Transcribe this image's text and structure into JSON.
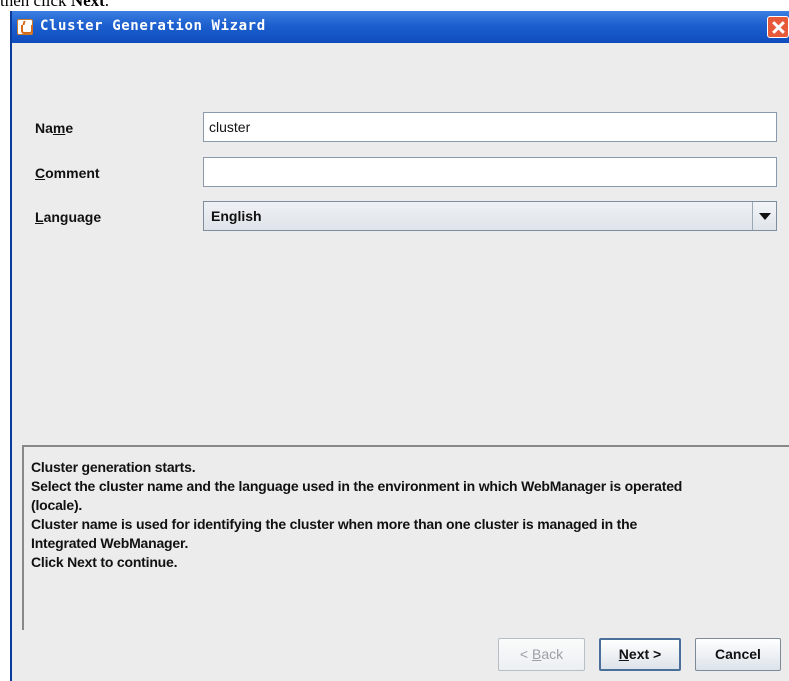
{
  "doc": {
    "prefix": "then click ",
    "bold": "Next",
    "suffix": "."
  },
  "window": {
    "title": "Cluster Generation Wizard"
  },
  "form": {
    "name_label_pre": "Na",
    "name_label_mnemonic": "m",
    "name_label_post": "e",
    "name_value": "cluster",
    "comment_label_mnemonic": "C",
    "comment_label_post": "omment",
    "comment_value": "",
    "language_label_mnemonic": "L",
    "language_label_post": "anguage",
    "language_value": "English"
  },
  "description": {
    "lines": [
      "Cluster generation starts.",
      "Select the cluster name and the language used in the environment in which WebManager is operated",
      "(locale).",
      "Cluster name is used for identifying the cluster when more than one cluster is managed in the",
      "Integrated WebManager.",
      "Click Next to continue."
    ]
  },
  "buttons": {
    "back_pre": "< ",
    "back_mnemonic": "B",
    "back_post": "ack",
    "next_mnemonic": "N",
    "next_post": "ext >",
    "cancel": "Cancel"
  }
}
